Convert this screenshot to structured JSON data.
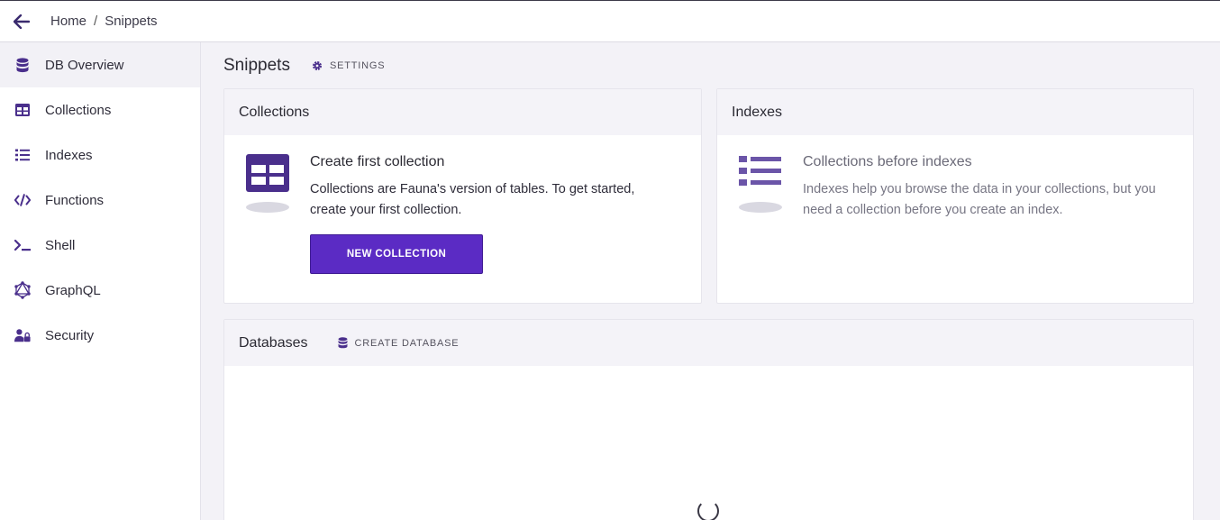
{
  "breadcrumb": {
    "home": "Home",
    "separator": "/",
    "current": "Snippets"
  },
  "sidebar": {
    "items": [
      {
        "label": "DB Overview",
        "icon": "database-icon",
        "active": true
      },
      {
        "label": "Collections",
        "icon": "table-icon",
        "active": false
      },
      {
        "label": "Indexes",
        "icon": "list-icon",
        "active": false
      },
      {
        "label": "Functions",
        "icon": "code-icon",
        "active": false
      },
      {
        "label": "Shell",
        "icon": "terminal-icon",
        "active": false
      },
      {
        "label": "GraphQL",
        "icon": "graphql-icon",
        "active": false
      },
      {
        "label": "Security",
        "icon": "user-lock-icon",
        "active": false
      }
    ]
  },
  "page": {
    "title": "Snippets",
    "settings_label": "SETTINGS"
  },
  "collections_card": {
    "title": "Collections",
    "empty_title": "Create first collection",
    "empty_desc": "Collections are Fauna's version of tables. To get started, create your first collection.",
    "button_label": "NEW COLLECTION"
  },
  "indexes_card": {
    "title": "Indexes",
    "empty_title": "Collections before indexes",
    "empty_desc": "Indexes help you browse the data in your collections, but you need a collection before you create an index."
  },
  "databases_card": {
    "title": "Databases",
    "create_label": "CREATE DATABASE"
  },
  "colors": {
    "accent": "#5b2bc4",
    "icon": "#4a2f8c",
    "muted_icon": "#8e7dbf"
  }
}
